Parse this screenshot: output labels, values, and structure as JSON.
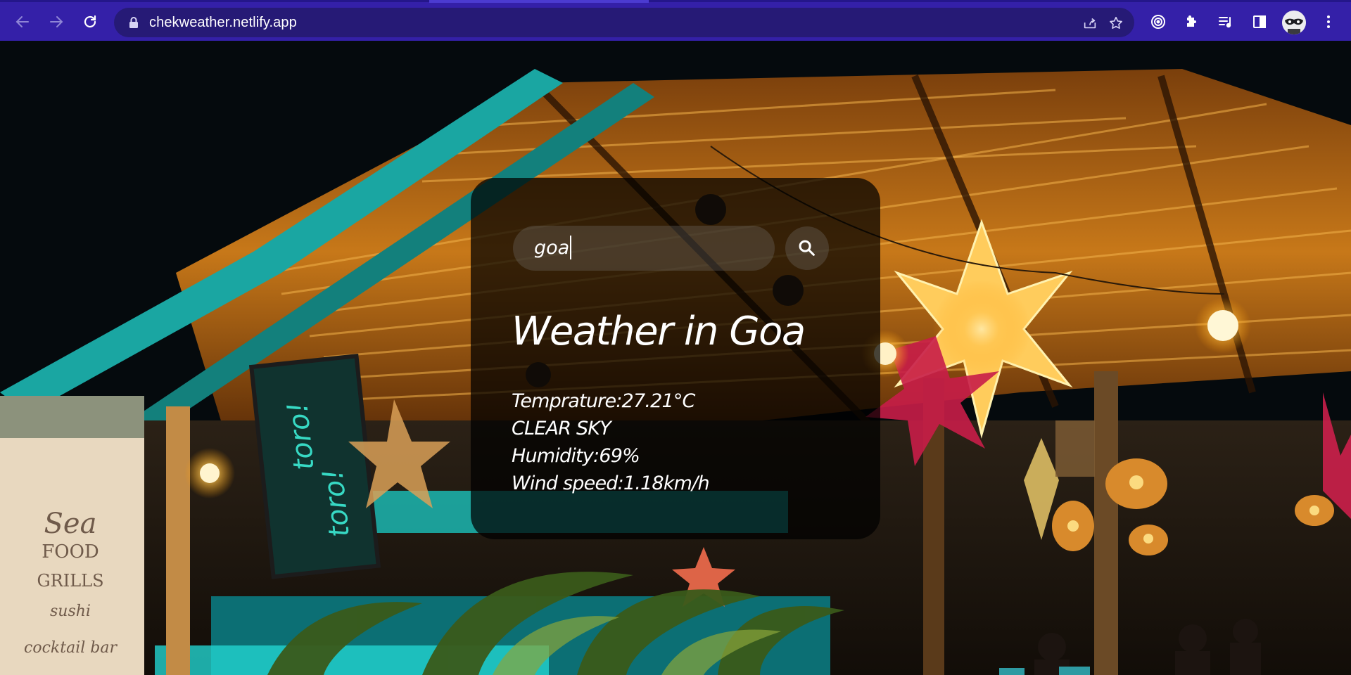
{
  "browser": {
    "url": "chekweather.netlify.app",
    "icons": {
      "back": "arrow-left-icon",
      "forward": "arrow-right-icon",
      "reload": "reload-icon",
      "lock": "lock-icon",
      "share": "share-icon",
      "bookmark": "star-icon",
      "extension1": "target-icon",
      "extensions": "puzzle-icon",
      "media": "playlist-icon",
      "sidepanel": "side-panel-icon",
      "profile": "avatar",
      "menu": "kebab-menu-icon"
    },
    "colors": {
      "toolbar": "#3420a8",
      "omnibox": "#261a76"
    }
  },
  "weather_app": {
    "search": {
      "value": "goa",
      "icon": "search-icon"
    },
    "title": "Weather in Goa",
    "temperature": "Temprature:27.21°C",
    "description": "CLEAR SKY",
    "humidity": "Humidity:69%",
    "wind": "Wind speed:1.18km/h"
  },
  "background": {
    "sign_text_1": "toro!",
    "sign_text_2": "toro!",
    "banner_lines": [
      "Sea",
      "FOOD",
      "GRILLS",
      "sushi",
      "cocktail bar"
    ]
  }
}
